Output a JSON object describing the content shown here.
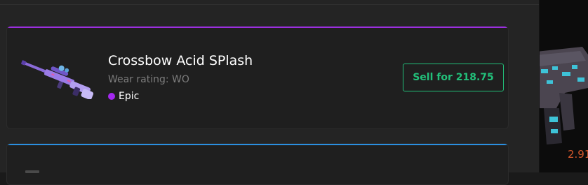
{
  "inventory": {
    "items": [
      {
        "name": "Crossbow Acid SPlash",
        "wear": "Wear rating: WO",
        "rarity": {
          "label": "Epic",
          "color": "#a428f0"
        },
        "accent_color": "#9b2ee0",
        "sell_label": "Sell for 218.75",
        "image_icon": "crossbow-icon"
      },
      {
        "accent_color": "#2a8fe0"
      }
    ]
  },
  "side_preview": {
    "price": "2.91",
    "image_icon": "rifle-icon"
  },
  "colors": {
    "sell_green": "#22c07a",
    "price_orange": "#d6582c"
  }
}
